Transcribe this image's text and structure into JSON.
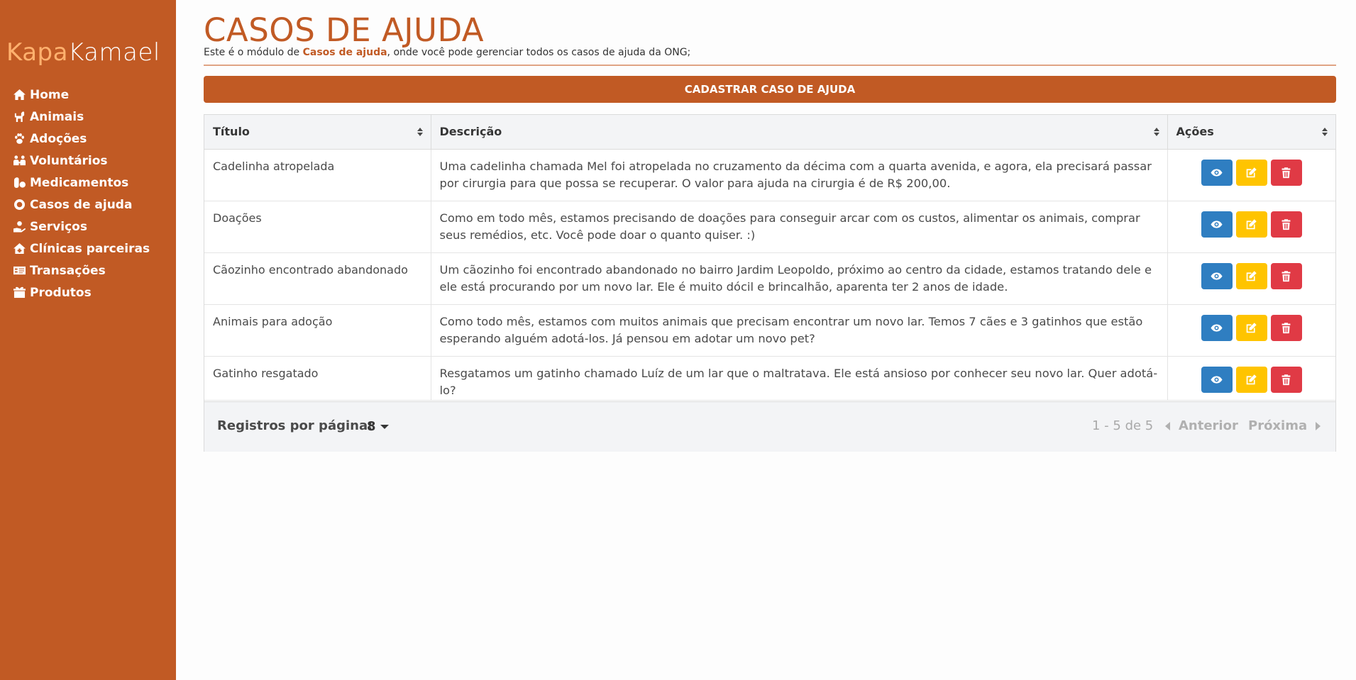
{
  "app": {
    "logo_part1": "Kapa",
    "logo_part2": "Kamael"
  },
  "colors": {
    "brand": "#c15a24",
    "view_button": "#2f7ec1",
    "edit_button": "#ffc400",
    "delete_button": "#e03a45"
  },
  "sidebar": {
    "items": [
      {
        "label": "Home",
        "icon": "home-icon"
      },
      {
        "label": "Animais",
        "icon": "dog-icon"
      },
      {
        "label": "Adoções",
        "icon": "paw-icon"
      },
      {
        "label": "Voluntários",
        "icon": "volunteers-icon"
      },
      {
        "label": "Medicamentos",
        "icon": "pills-icon"
      },
      {
        "label": "Casos de ajuda",
        "icon": "life-ring-icon"
      },
      {
        "label": "Serviços",
        "icon": "hand-service-icon"
      },
      {
        "label": "Clínicas parceiras",
        "icon": "clinic-house-icon"
      },
      {
        "label": "Transações",
        "icon": "card-icon"
      },
      {
        "label": "Produtos",
        "icon": "box-icon"
      }
    ]
  },
  "header": {
    "title": "CASOS DE AJUDA",
    "subtitle_prefix": "Este é o módulo de ",
    "subtitle_bold": "Casos de ajuda",
    "subtitle_suffix": ", onde você pode gerenciar todos os casos de ajuda da ONG;"
  },
  "toolbar": {
    "register_label": "CADASTRAR CASO DE AJUDA"
  },
  "table": {
    "columns": [
      "Título",
      "Descrição",
      "Ações"
    ],
    "rows": [
      {
        "title": "Cadelinha atropelada",
        "description": "Uma cadelinha chamada Mel foi atropelada no cruzamento da décima com a quarta avenida, e agora, ela precisará passar por cirurgia para que possa se recuperar. O valor para ajuda na cirurgia é de R$ 200,00."
      },
      {
        "title": "Doações",
        "description": "Como em todo mês, estamos precisando de doações para conseguir arcar com os custos, alimentar os animais, comprar seus remédios, etc. Você pode doar o quanto quiser. :)"
      },
      {
        "title": "Cãozinho encontrado abandonado",
        "description": "Um cãozinho foi encontrado abandonado no bairro Jardim Leopoldo, próximo ao centro da cidade, estamos tratando dele e ele está procurando por um novo lar. Ele é muito dócil e brincalhão, aparenta ter 2 anos de idade."
      },
      {
        "title": "Animais para adoção",
        "description": "Como todo mês, estamos com muitos animais que precisam encontrar um novo lar. Temos 7 cães e 3 gatinhos que estão esperando alguém adotá-los. Já pensou em adotar um novo pet?"
      },
      {
        "title": "Gatinho resgatado",
        "description": "Resgatamos um gatinho chamado Luíz de um lar que o maltratava. Ele está ansioso por conhecer seu novo lar. Quer adotá-lo?"
      }
    ]
  },
  "pagination": {
    "rows_per_page_label": "Registros por página:",
    "rows_per_page_value": "8",
    "range": "1 - 5 de 5",
    "prev_label": "Anterior",
    "next_label": "Próxima"
  }
}
